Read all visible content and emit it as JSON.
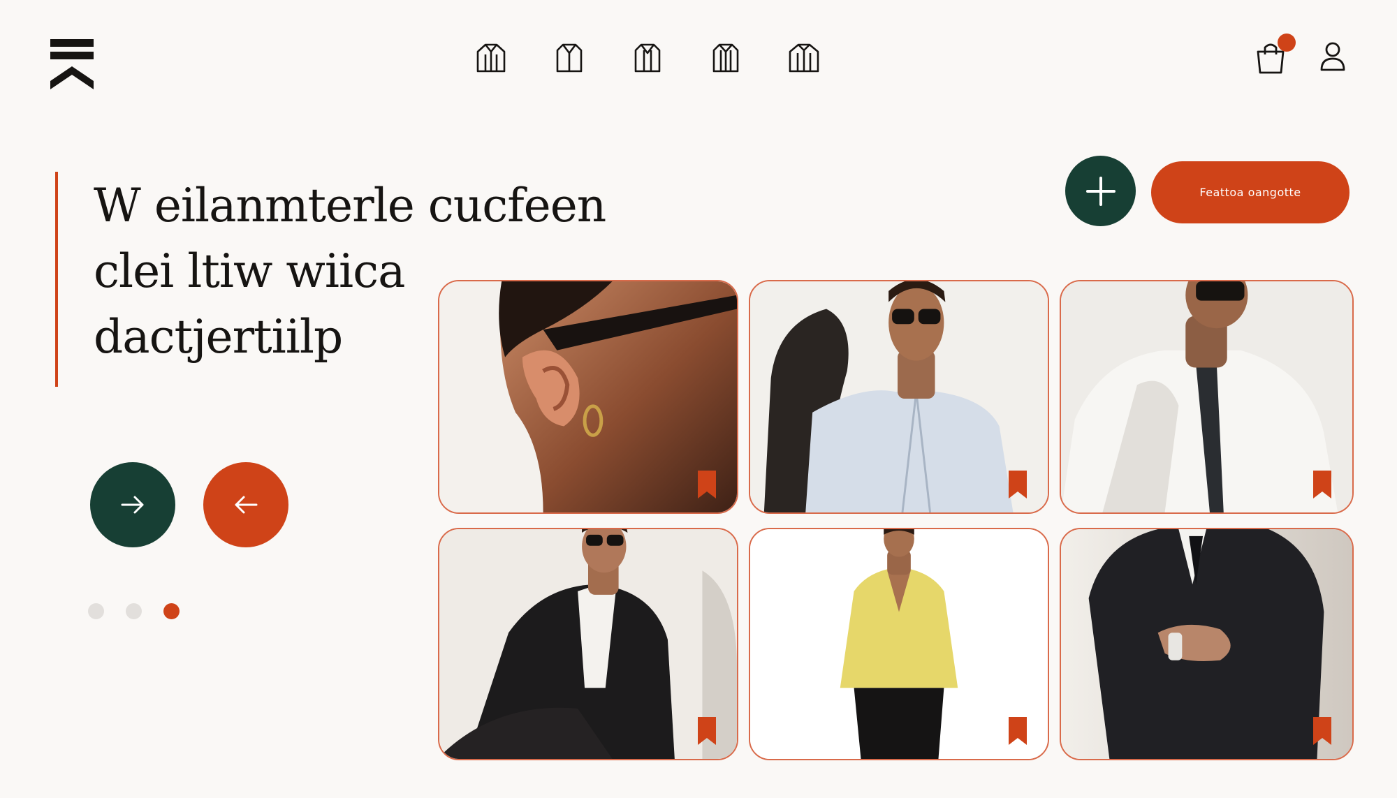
{
  "colors": {
    "background": "#faf8f6",
    "ink": "#161412",
    "accent_orange": "#cf4318",
    "accent_green": "#173f34",
    "dot_inactive": "#e2dfdc",
    "card_border": "#d96a4a"
  },
  "header": {
    "logo_icon": "stacked-chevron-logo",
    "nav_icons": [
      "shirt-icon",
      "shirt-icon",
      "shirt-icon",
      "shirt-icon",
      "shirt-icon"
    ],
    "cart_icon": "shopping-bag-icon",
    "user_icon": "user-icon"
  },
  "hero": {
    "headline_lines": [
      "W eilanmterle cucfeen",
      "clei ltiw wiica",
      "dactjertiilp"
    ]
  },
  "controls": {
    "next_icon": "arrow-right-icon",
    "prev_icon": "arrow-left-icon",
    "pagination": {
      "total": 3,
      "active": 3
    },
    "add_icon": "plus-icon",
    "cta_label": "Feattoa oangotte"
  },
  "gallery": {
    "items": [
      {
        "subject": "ear-with-gold-hoop-earring",
        "bookmark_icon": "bookmark-icon"
      },
      {
        "subject": "man-in-light-blue-shirt-and-sunglasses",
        "bookmark_icon": "bookmark-icon"
      },
      {
        "subject": "man-in-white-shirt-and-black-tie",
        "bookmark_icon": "bookmark-icon"
      },
      {
        "subject": "man-in-black-blazer-seated",
        "bookmark_icon": "bookmark-icon"
      },
      {
        "subject": "man-in-yellow-blazer",
        "bookmark_icon": "bookmark-icon"
      },
      {
        "subject": "man-in-black-suit-hands-clasped",
        "bookmark_icon": "bookmark-icon"
      }
    ]
  }
}
